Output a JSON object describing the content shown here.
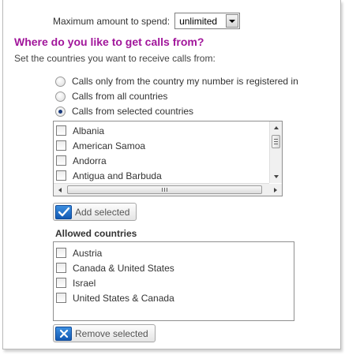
{
  "colors": {
    "heading": "#a1169b",
    "button_icon": "#1a6dc8"
  },
  "spend": {
    "label": "Maximum amount to spend:",
    "selected": "unlimited"
  },
  "calls_section": {
    "heading": "Where do you like to get calls from?",
    "description": "Set the countries you want to receive calls from:",
    "options": [
      {
        "label": "Calls only from the country my number is registered in",
        "checked": false
      },
      {
        "label": "Calls from all countries",
        "checked": false
      },
      {
        "label": "Calls from selected countries",
        "checked": true
      }
    ]
  },
  "available_countries": {
    "items": [
      "Albania",
      "American Samoa",
      "Andorra",
      "Antigua and Barbuda"
    ],
    "add_button": "Add selected"
  },
  "allowed_countries": {
    "title": "Allowed countries",
    "items": [
      "Austria",
      "Canada & United States",
      "Israel",
      "United States & Canada"
    ],
    "remove_button": "Remove selected"
  },
  "icons": {
    "dropdown": "chevron-down-icon",
    "add": "checkmark-icon",
    "remove": "close-icon"
  }
}
